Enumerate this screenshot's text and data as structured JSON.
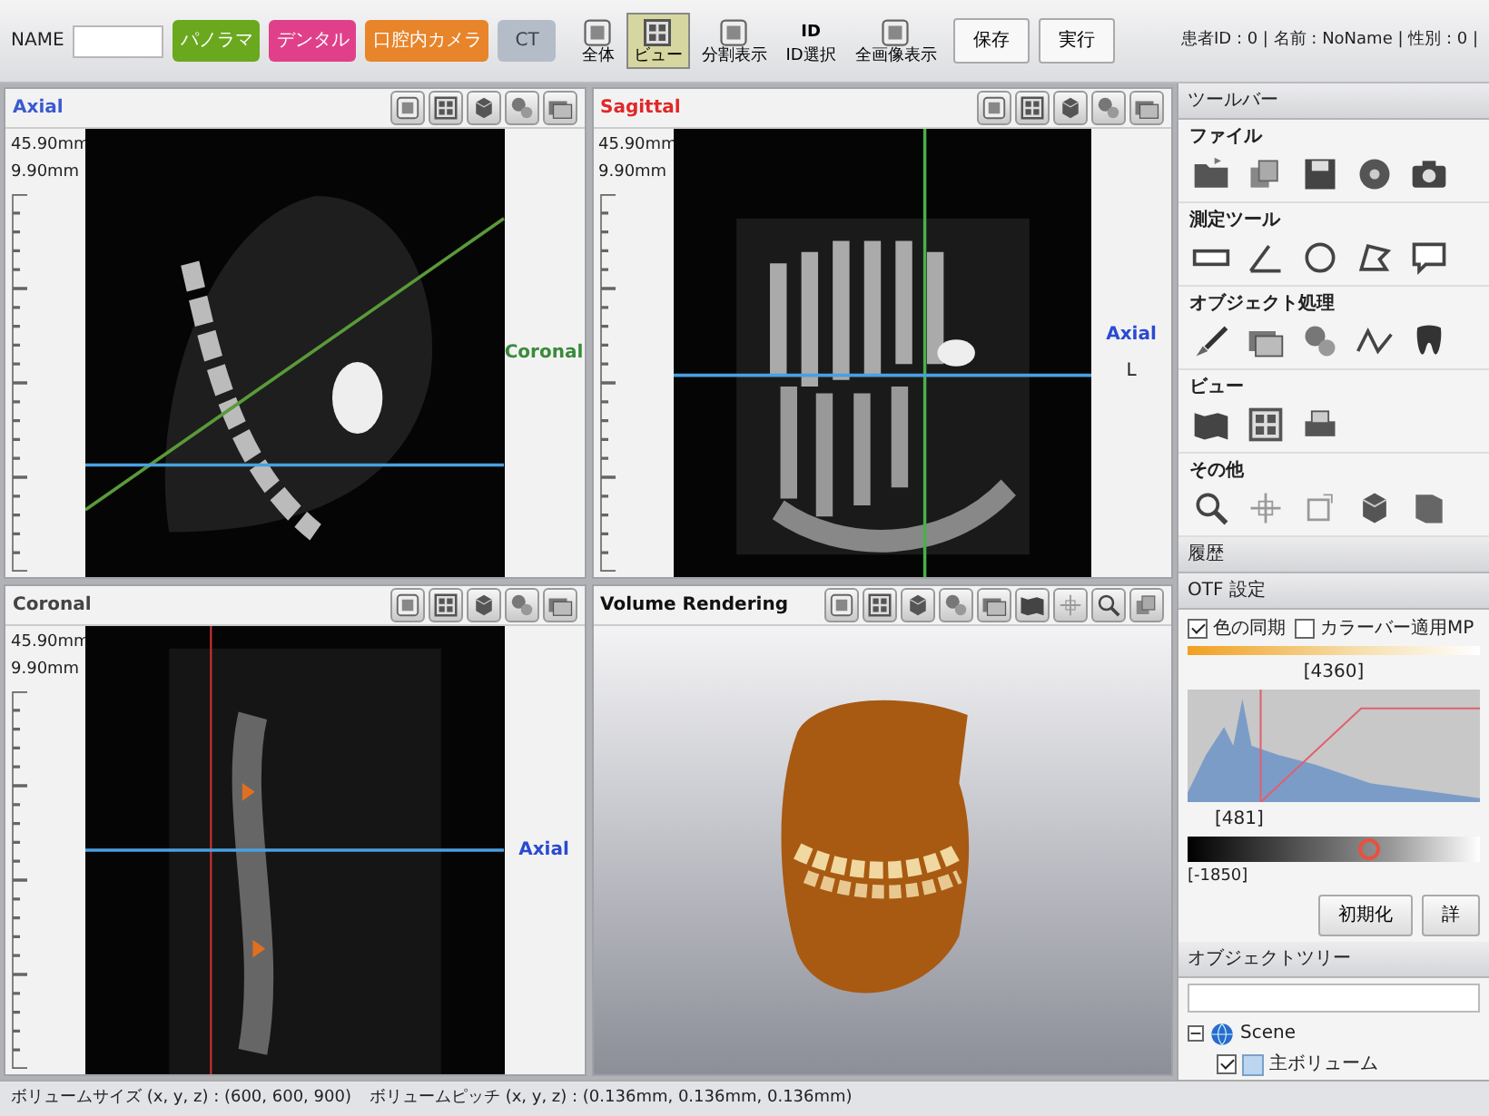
{
  "top_bar": {
    "name_label": "NAME",
    "modes": [
      {
        "label": "パノラマ",
        "color": "#6aa81e",
        "disabled": false
      },
      {
        "label": "デンタル",
        "color": "#e0408a",
        "disabled": false
      },
      {
        "label": "口腔内カメラ",
        "color": "#e8842a",
        "disabled": false
      },
      {
        "label": "CT",
        "color": "#b4bcc8",
        "disabled": true
      }
    ],
    "tools": [
      {
        "caption": "全体",
        "selected": false
      },
      {
        "caption": "ビュー",
        "selected": true
      },
      {
        "caption": "分割表示",
        "selected": false
      },
      {
        "caption": "ID選択",
        "selected": false,
        "glyph": "ID"
      },
      {
        "caption": "全画像表示",
        "selected": false
      }
    ],
    "buttons": [
      "保存",
      "実行"
    ],
    "patient_info": "患者ID : 0 | 名前 : NoName | 性別 : 0 |"
  },
  "views": [
    {
      "kind": "axial",
      "title": "Axial",
      "color": "#3a5ad0",
      "measurements": [
        "45.90mm",
        "9.90mm"
      ],
      "line_label": "Coronal"
    },
    {
      "kind": "sagittal",
      "title": "Sagittal",
      "color": "#e02828",
      "measurements": [
        "45.90mm",
        "9.90mm"
      ],
      "line_label": "Axial",
      "marker": "L"
    },
    {
      "kind": "coronal",
      "title": "Coronal",
      "color": "#444444",
      "measurements": [
        "45.90mm",
        "9.90mm"
      ],
      "line_label": "Axial"
    },
    {
      "kind": "volume",
      "title": "Volume Rendering",
      "color": "#111111"
    }
  ],
  "status_bar": [
    "ボリュームサイズ (x, y, z) : (600, 600, 900)",
    "ボリュームピッチ (x, y, z) : (0.136mm, 0.136mm, 0.136mm)"
  ],
  "toolbar_panel": {
    "title": "ツールバー",
    "sections": [
      "ファイル",
      "測定ツール",
      "オブジェクト処理",
      "ビュー",
      "その他"
    ]
  },
  "history": {
    "title": "履歴"
  },
  "otf": {
    "title": "OTF 設定",
    "options": [
      {
        "label": "色の同期",
        "checked": true
      },
      {
        "label": "カラーバー適用MP",
        "checked": false
      }
    ],
    "peak_label": "[4360]",
    "base_label": "[481]",
    "min_label": "[-1850]",
    "level": 0.62,
    "buttons": [
      "初期化",
      "詳"
    ]
  },
  "object_tree": {
    "title": "オブジェクトツリー",
    "items": [
      {
        "label": "Scene",
        "expanded": true,
        "children": [
          {
            "label": "主ボリューム",
            "checked": true
          }
        ]
      }
    ]
  }
}
